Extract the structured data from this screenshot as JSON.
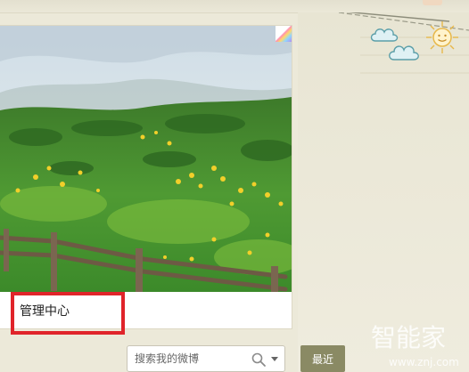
{
  "card": {
    "manage_label": "管理中心"
  },
  "search": {
    "placeholder": "搜索我的微博"
  },
  "tabs": {
    "recent": "最近"
  },
  "watermark": {
    "brand": "智能家",
    "url": "www.znj.com"
  },
  "icons": {
    "search": "search-icon",
    "dropdown": "chevron-down-icon",
    "cloud": "cloud-icon",
    "sun": "sun-icon",
    "photo_badge": "photo-corner-badge"
  },
  "colors": {
    "background": "#ece9d9",
    "highlight": "#e0242a",
    "recent_tab": "#8a8a64"
  }
}
